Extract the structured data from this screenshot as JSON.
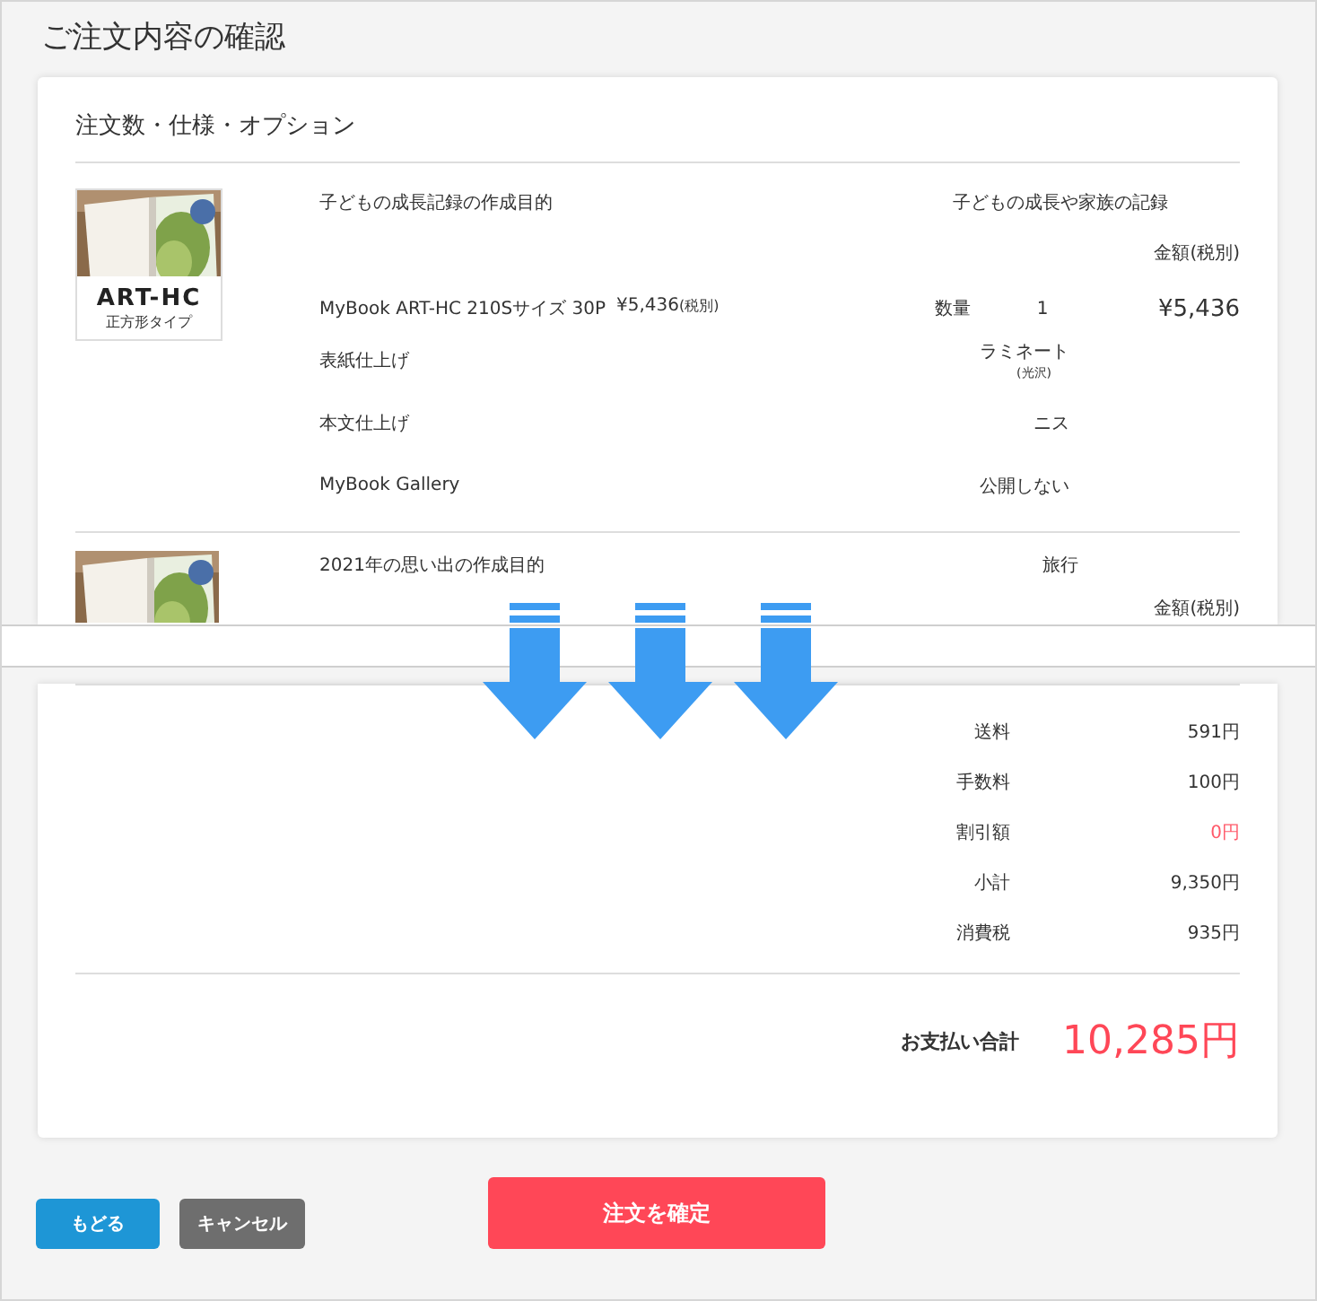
{
  "page_title": "ご注文内容の確認",
  "section_title": "注文数・仕様・オプション",
  "items": [
    {
      "thumbnail": {
        "kind": "picture",
        "caption_title": "ART-HC",
        "caption_sub": "正方形タイプ"
      },
      "purpose_label": "子どもの成長記録の作成目的",
      "purpose_value": "子どもの成長や家族の記録",
      "price_header": "金額(税別)",
      "product_name": "MyBook ART-HC 210Sサイズ 30P",
      "unit_price": "¥5,436",
      "tax_note": "(税別)",
      "quantity_label": "数量",
      "quantity": "1",
      "price": "¥5,436",
      "options": [
        {
          "label": "表紙仕上げ",
          "value": "ラミネート",
          "note": "(光沢)"
        },
        {
          "label": "本文仕上げ",
          "value": "ニス"
        },
        {
          "label": "MyBook Gallery",
          "value": "公開しない"
        }
      ]
    },
    {
      "purpose_label": "2021年の思い出の作成目的",
      "purpose_value": "旅行",
      "price_header": "金額(税別)"
    }
  ],
  "summary": [
    {
      "label": "送料",
      "value": "591円",
      "highlight": false
    },
    {
      "label": "手数料",
      "value": "100円",
      "highlight": false
    },
    {
      "label": "割引額",
      "value": "0円",
      "highlight": true
    },
    {
      "label": "小計",
      "value": "9,350円",
      "highlight": false
    },
    {
      "label": "消費税",
      "value": "935円",
      "highlight": false
    }
  ],
  "total": {
    "label": "お支払い合計",
    "value": "10,285円"
  },
  "buttons": [
    {
      "label": "もどる",
      "kind": "back"
    },
    {
      "label": "キャンセル",
      "kind": "cancel"
    },
    {
      "label": "注文を確定",
      "kind": "confirm"
    }
  ]
}
